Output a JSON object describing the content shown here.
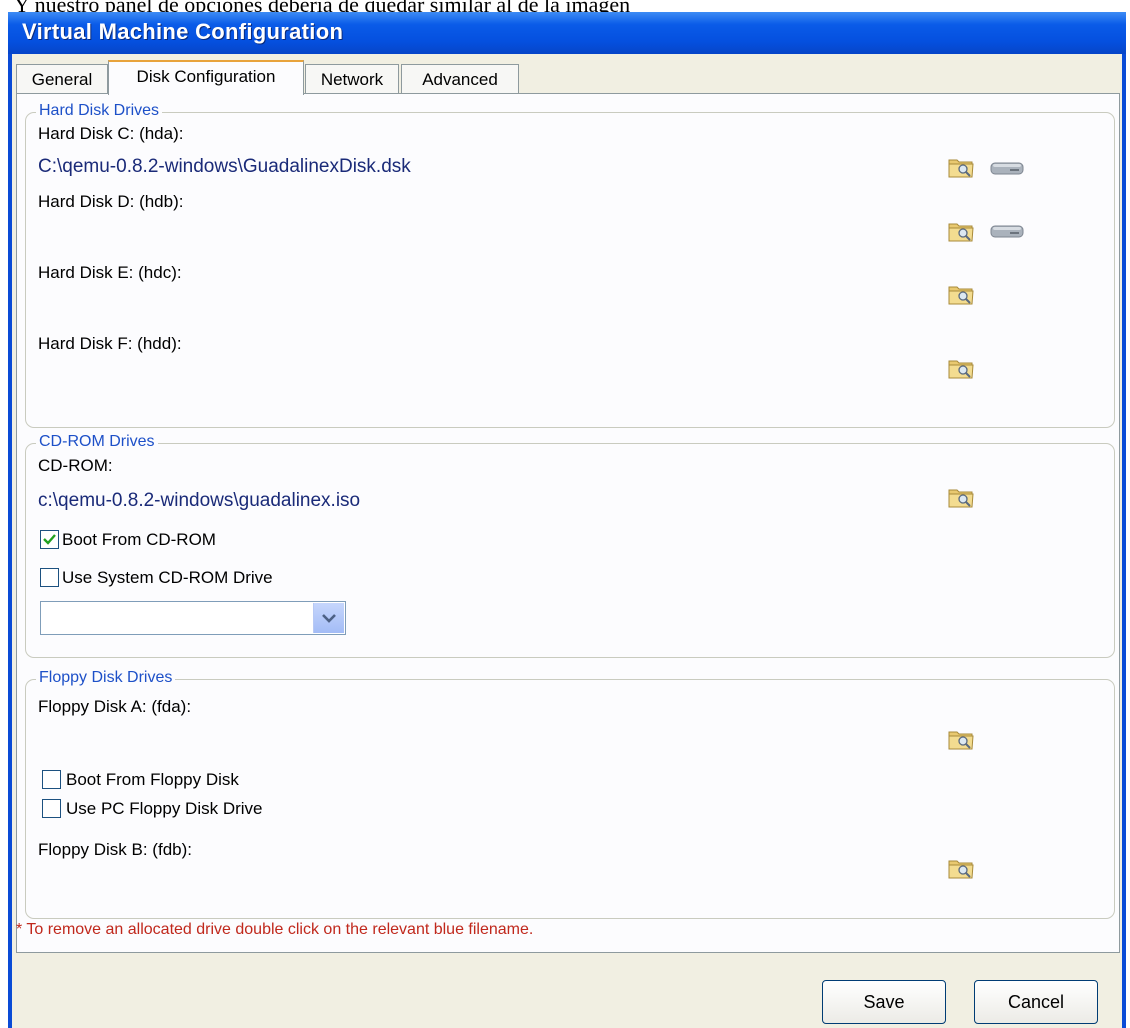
{
  "caption": "Y nuestro panel de opciones debería de quedar similar al de la imagen",
  "window": {
    "title": "Virtual Machine Configuration"
  },
  "tabs": [
    {
      "label": "General",
      "active": false
    },
    {
      "label": "Disk Configuration",
      "active": true
    },
    {
      "label": "Network",
      "active": false
    },
    {
      "label": "Advanced",
      "active": false
    }
  ],
  "hard_disks": {
    "title": "Hard Disk Drives",
    "items": [
      {
        "label": "Hard Disk C: (hda):",
        "path": "C:\\qemu-0.8.2-windows\\GuadalinexDisk.dsk",
        "browse_icon": "folder-browse-icon",
        "create_icon": "hard-drive-icon"
      },
      {
        "label": "Hard Disk D: (hdb):",
        "path": "",
        "browse_icon": "folder-browse-icon",
        "create_icon": "hard-drive-icon"
      },
      {
        "label": "Hard Disk E: (hdc):",
        "path": "",
        "browse_icon": "folder-browse-icon"
      },
      {
        "label": "Hard Disk F: (hdd):",
        "path": "",
        "browse_icon": "folder-browse-icon"
      }
    ]
  },
  "cdrom": {
    "title": "CD-ROM Drives",
    "label": "CD-ROM:",
    "path": "c:\\qemu-0.8.2-windows\\guadalinex.iso",
    "boot_label": "Boot From CD-ROM",
    "boot_checked": true,
    "system_label": "Use System CD-ROM Drive",
    "system_checked": false,
    "drive_select_value": ""
  },
  "floppy": {
    "title": "Floppy Disk Drives",
    "a_label": "Floppy Disk A: (fda):",
    "boot_label": "Boot From Floppy Disk",
    "boot_checked": false,
    "pc_label": "Use PC Floppy Disk Drive",
    "pc_checked": false,
    "b_label": "Floppy Disk B: (fdb):"
  },
  "note": "* To remove an allocated drive double click on the relevant blue filename.",
  "buttons": {
    "save": "Save",
    "cancel": "Cancel"
  },
  "colors": {
    "title_bar": "#0a5be8",
    "group_title": "#1d50c8",
    "path_text": "#1a2a78",
    "note": "#c0281c",
    "active_tab_accent": "#e8a33c"
  }
}
